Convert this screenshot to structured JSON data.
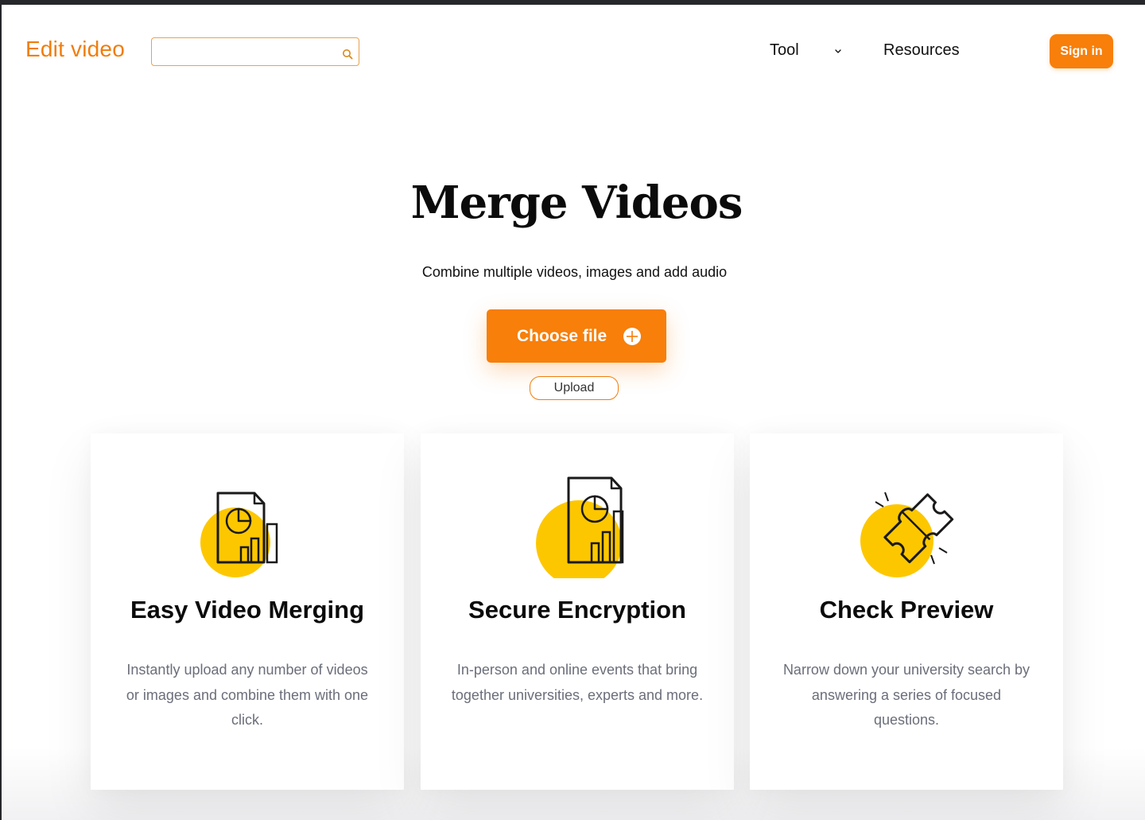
{
  "header": {
    "logo": "Edit video",
    "search": {
      "value": "",
      "placeholder": ""
    },
    "nav": [
      {
        "label": "Tool",
        "has_dropdown": true
      },
      {
        "label": "Resources",
        "has_dropdown": false
      }
    ],
    "signin_label": "Sign in"
  },
  "hero": {
    "title": "Merge Videos",
    "subtitle": "Combine multiple videos, images and add audio",
    "choose_file_label": "Choose file",
    "upload_label": "Upload"
  },
  "features": [
    {
      "icon": "document-chart-icon",
      "title": "Easy Video Merging",
      "description": "Instantly upload any number of videos or images and combine them with one click."
    },
    {
      "icon": "document-chart-icon",
      "title": "Secure Encryption",
      "description": "In-person and online events that bring together universities, experts and more."
    },
    {
      "icon": "puzzle-icon",
      "title": "Check Preview",
      "description": "Narrow down your university search by answering a series of focused questions."
    }
  ],
  "colors": {
    "accent": "#f77f0a",
    "icon_highlight": "#fdc700",
    "title_text": "#0b0b0b",
    "body_text": "#6b6e7a"
  }
}
